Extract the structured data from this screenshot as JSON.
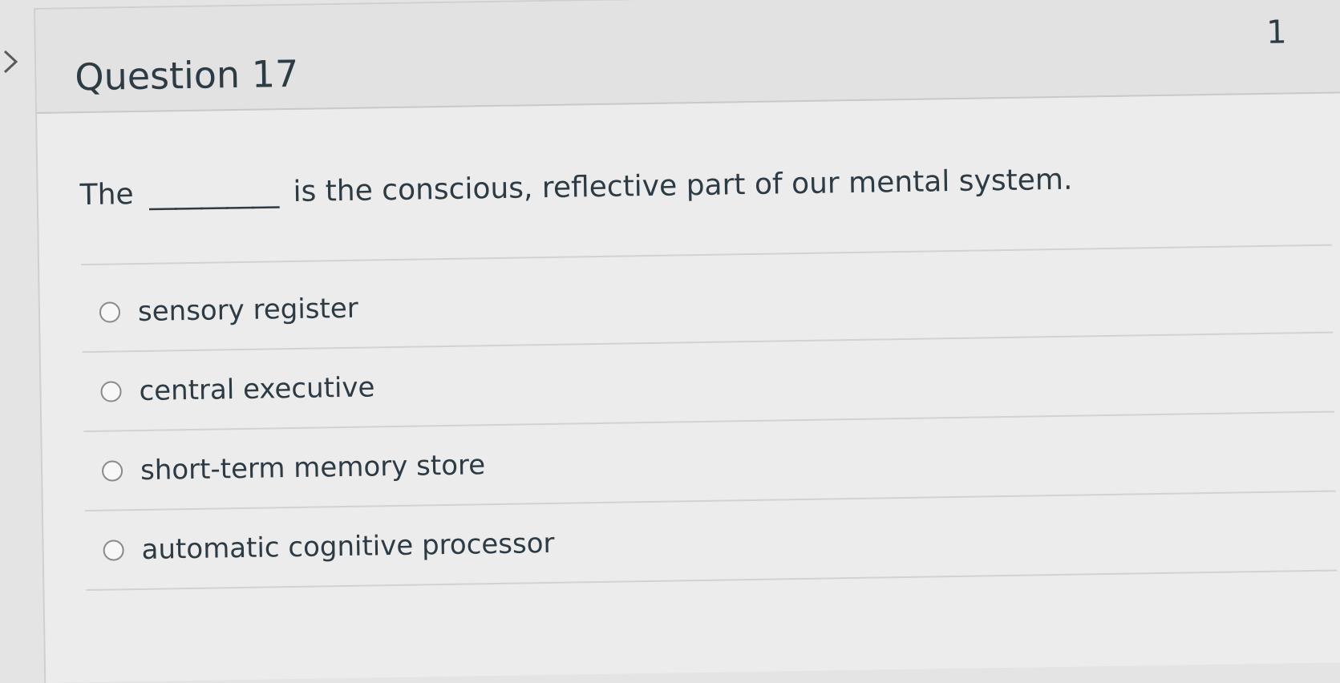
{
  "question": {
    "title": "Question 17",
    "points": "1",
    "text_before": "The",
    "blank": "__________",
    "text_after": "is the conscious, reflective part of our mental system."
  },
  "answers": [
    {
      "label": "sensory register"
    },
    {
      "label": "central executive"
    },
    {
      "label": "short-term memory store"
    },
    {
      "label": "automatic cognitive processor"
    }
  ],
  "icons": {
    "nav": "chevron-right-icon"
  }
}
